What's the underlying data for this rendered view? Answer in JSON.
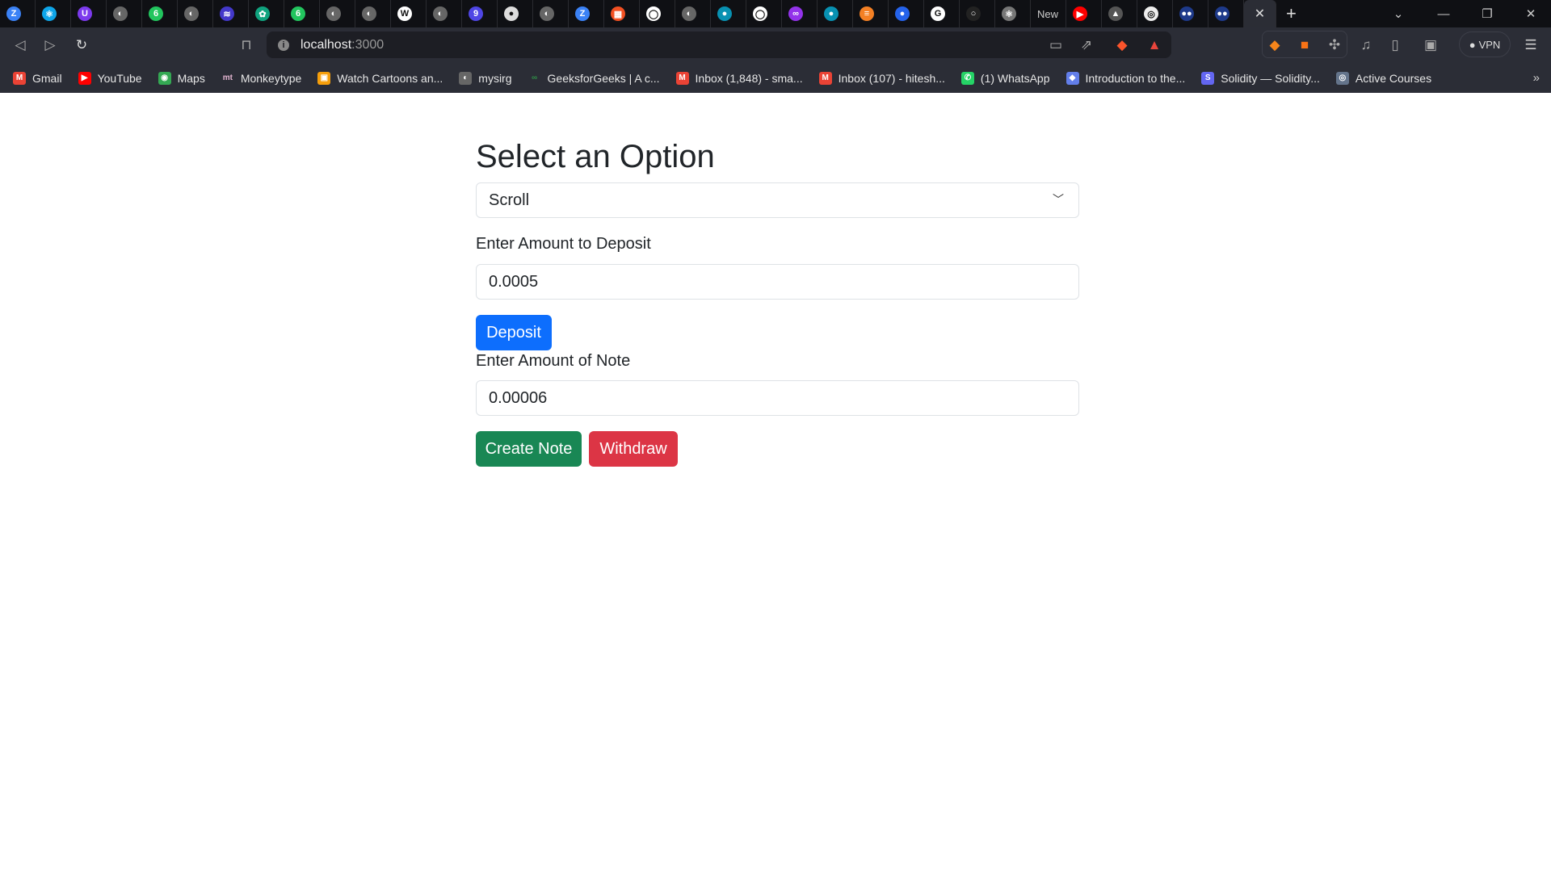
{
  "browser": {
    "tabs": [
      {
        "icon": "Z",
        "color": "#3b82f6"
      },
      {
        "icon": "⚛",
        "color": "#0ea5e9"
      },
      {
        "icon": "U",
        "color": "#7c3aed"
      },
      {
        "icon": "◐",
        "color": "#666"
      },
      {
        "icon": "6",
        "color": "#22c55e"
      },
      {
        "icon": "◐",
        "color": "#666"
      },
      {
        "icon": "≋",
        "color": "#4338ca"
      },
      {
        "icon": "✿",
        "color": "#10a37f"
      },
      {
        "icon": "6",
        "color": "#22c55e"
      },
      {
        "icon": "◐",
        "color": "#666"
      },
      {
        "icon": "◐",
        "color": "#666"
      },
      {
        "icon": "W",
        "color": "#fff"
      },
      {
        "icon": "◐",
        "color": "#666"
      },
      {
        "icon": "9",
        "color": "#4f46e5"
      },
      {
        "icon": "●",
        "color": "#ddd"
      },
      {
        "icon": "◐",
        "color": "#666"
      },
      {
        "icon": "Z",
        "color": "#3b82f6"
      },
      {
        "icon": "▦",
        "color": "#f25022"
      },
      {
        "icon": "◯",
        "color": "#fff"
      },
      {
        "icon": "◐",
        "color": "#666"
      },
      {
        "icon": "●",
        "color": "#0891b2"
      },
      {
        "icon": "◯",
        "color": "#fff"
      },
      {
        "icon": "∞",
        "color": "#9333ea"
      },
      {
        "icon": "●",
        "color": "#0891b2"
      },
      {
        "icon": "≡",
        "color": "#f48024"
      },
      {
        "icon": "●",
        "color": "#2563eb"
      },
      {
        "icon": "G",
        "color": "#fff"
      },
      {
        "icon": "○",
        "color": "#222"
      },
      {
        "icon": "⚛",
        "color": "#777"
      },
      {
        "icon": "New",
        "color": "transparent"
      },
      {
        "icon": "▶",
        "color": "#ff0000"
      },
      {
        "icon": "▲",
        "color": "#555"
      },
      {
        "icon": "◎",
        "color": "#eee"
      },
      {
        "icon": "●●",
        "color": "#1e3a8a"
      },
      {
        "icon": "●●",
        "color": "#1e3a8a"
      }
    ],
    "active_tab_close": "✕",
    "new_tab": "+",
    "window_controls": {
      "tab_search": "⌄",
      "minimize": "—",
      "restore": "❐",
      "close": "✕"
    },
    "url_host": "localhost",
    "url_port": ":3000",
    "vpn_label": "VPN",
    "bookmarks": [
      {
        "label": "Gmail",
        "icon": "M",
        "color": "#ea4335"
      },
      {
        "label": "YouTube",
        "icon": "▶",
        "color": "#ff0000"
      },
      {
        "label": "Maps",
        "icon": "◉",
        "color": "#34a853"
      },
      {
        "label": "Monkeytype",
        "icon": "mt",
        "color": "transparent"
      },
      {
        "label": "Watch Cartoons an...",
        "icon": "▣",
        "color": "#f59e0b"
      },
      {
        "label": "mysirg",
        "icon": "◐",
        "color": "#666"
      },
      {
        "label": "GeeksforGeeks | A c...",
        "icon": "∞",
        "color": "transparent"
      },
      {
        "label": "Inbox (1,848) - sma...",
        "icon": "M",
        "color": "#ea4335"
      },
      {
        "label": "Inbox (107) - hitesh...",
        "icon": "M",
        "color": "#ea4335"
      },
      {
        "label": "(1) WhatsApp",
        "icon": "✆",
        "color": "#25d366"
      },
      {
        "label": "Introduction to the...",
        "icon": "◆",
        "color": "#627eea"
      },
      {
        "label": "Solidity — Solidity...",
        "icon": "S",
        "color": "#6366f1"
      },
      {
        "label": "Active Courses",
        "icon": "◎",
        "color": "#64748b"
      }
    ],
    "bookmarks_more": "»"
  },
  "page": {
    "title": "Select an Option",
    "select_value": "Scroll",
    "deposit_label": "Enter Amount to Deposit",
    "deposit_value": "0.0005",
    "deposit_button": "Deposit",
    "note_label": "Enter Amount of Note",
    "note_value": "0.00006",
    "create_note_button": "Create Note",
    "withdraw_button": "Withdraw"
  },
  "colors": {
    "primary": "#0d6efd",
    "success": "#198754",
    "danger": "#dc3545"
  }
}
